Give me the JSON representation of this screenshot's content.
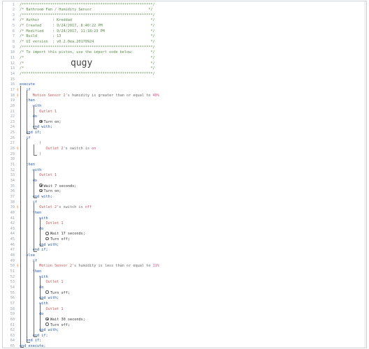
{
  "lines": [
    {
      "n": "1",
      "text": "/************************************************************/",
      "cls": "comment"
    },
    {
      "n": "2",
      "text": "/* Bathroom Fan / Humidity Sensor                          */",
      "cls": "comment"
    },
    {
      "n": "3",
      "text": "/************************************************************/",
      "cls": "comment"
    },
    {
      "n": "4",
      "text": "/* Author      : Kreddad                                    */",
      "cls": "comment"
    },
    {
      "n": "5",
      "text": "/* Created     : 9/24/2017, 8:40:22 PM                      */",
      "cls": "comment"
    },
    {
      "n": "6",
      "text": "/* Modified    : 9/24/2017, 11:18:23 PM                     */",
      "cls": "comment"
    },
    {
      "n": "7",
      "text": "/* Build       : 13                                         */",
      "cls": "comment"
    },
    {
      "n": "8",
      "text": "/* UI version  : v0.2.0ea.20170924                          */",
      "cls": "comment"
    },
    {
      "n": "9",
      "text": "/************************************************************/",
      "cls": "comment"
    },
    {
      "n": "10",
      "text": "/* To import this piston, use the import code below:        */",
      "cls": "comment"
    },
    {
      "n": "11",
      "text": "/*                                                          */",
      "cls": "comment"
    },
    {
      "n": "12",
      "text": "/*                                                          */",
      "cls": "comment"
    },
    {
      "n": "13",
      "text": "/*                                                          */",
      "cls": "comment"
    },
    {
      "n": "14",
      "text": "/************************************************************/",
      "cls": "comment"
    },
    {
      "n": "15",
      "text": ""
    },
    {
      "n": "16",
      "text": "execute",
      "cls": "kw"
    },
    {
      "n": "17",
      "text": "   if",
      "cls": "kw",
      "mark": true
    },
    {
      "n": "18",
      "seg": [
        {
          "t": "      "
        },
        {
          "t": "Motion Sensor 2",
          "c": "dev"
        },
        {
          "t": "'s humidity is greater than or equal to ",
          "c": "op"
        },
        {
          "t": "40%",
          "c": "num"
        }
      ],
      "mark": true
    },
    {
      "n": "19",
      "text": "   then",
      "cls": "kw"
    },
    {
      "n": "20",
      "text": "      with",
      "cls": "kw"
    },
    {
      "n": "21",
      "text": "         Outlet 1",
      "cls": "dev"
    },
    {
      "n": "22",
      "text": "      do",
      "cls": "kw"
    },
    {
      "n": "23",
      "text": "         Turn on;",
      "cls": "act",
      "radio": "filled"
    },
    {
      "n": "24",
      "text": "      end with;",
      "cls": "kw"
    },
    {
      "n": "25",
      "text": "   end if;",
      "cls": "kw"
    },
    {
      "n": "26",
      "text": "   if",
      "cls": "kw"
    },
    {
      "n": "27",
      "text": "         (",
      "cls": "op"
    },
    {
      "n": "28",
      "seg": [
        {
          "t": "            "
        },
        {
          "t": "Outlet 2",
          "c": "dev"
        },
        {
          "t": "'s switch is ",
          "c": "op"
        },
        {
          "t": "on",
          "c": "num"
        }
      ],
      "mark": true
    },
    {
      "n": "29",
      "text": "         )",
      "cls": "op"
    },
    {
      "n": "30",
      "text": ""
    },
    {
      "n": "31",
      "text": "   then",
      "cls": "kw"
    },
    {
      "n": "32",
      "text": "      with",
      "cls": "kw"
    },
    {
      "n": "33",
      "text": "         Outlet 1",
      "cls": "dev"
    },
    {
      "n": "34",
      "text": "      do",
      "cls": "kw"
    },
    {
      "n": "35",
      "text": "         Wait 7 seconds;",
      "cls": "act",
      "radio": "filled"
    },
    {
      "n": "36",
      "text": "         Turn on;",
      "cls": "act",
      "radio": "filled"
    },
    {
      "n": "37",
      "text": "      end with;",
      "cls": "kw"
    },
    {
      "n": "38",
      "text": "      if",
      "cls": "kw"
    },
    {
      "n": "39",
      "seg": [
        {
          "t": "         "
        },
        {
          "t": "Outlet 2",
          "c": "dev"
        },
        {
          "t": "'s switch is ",
          "c": "op"
        },
        {
          "t": "off",
          "c": "num"
        }
      ],
      "mark": true
    },
    {
      "n": "40",
      "text": "      then",
      "cls": "kw"
    },
    {
      "n": "41",
      "text": "         with",
      "cls": "kw"
    },
    {
      "n": "42",
      "text": "            Outlet 1",
      "cls": "dev"
    },
    {
      "n": "43",
      "text": "         do",
      "cls": "kw"
    },
    {
      "n": "44",
      "text": "            Wait 17 seconds;",
      "cls": "act",
      "radio": "empty"
    },
    {
      "n": "45",
      "text": "            Turn off;",
      "cls": "act",
      "radio": "empty"
    },
    {
      "n": "46",
      "text": "         end with;",
      "cls": "kw"
    },
    {
      "n": "47",
      "text": "      end if;",
      "cls": "kw"
    },
    {
      "n": "48",
      "text": "   else",
      "cls": "kw"
    },
    {
      "n": "49",
      "text": "      if",
      "cls": "kw"
    },
    {
      "n": "50",
      "seg": [
        {
          "t": "         "
        },
        {
          "t": "Motion Sensor 2",
          "c": "dev"
        },
        {
          "t": "'s humidity is less than or equal to ",
          "c": "op"
        },
        {
          "t": "11%",
          "c": "num"
        }
      ],
      "mark": true
    },
    {
      "n": "51",
      "text": "      then",
      "cls": "kw"
    },
    {
      "n": "52",
      "text": "         with",
      "cls": "kw"
    },
    {
      "n": "53",
      "text": "            Outlet 1",
      "cls": "dev"
    },
    {
      "n": "54",
      "text": "         do",
      "cls": "kw"
    },
    {
      "n": "55",
      "text": "            Turn off;",
      "cls": "act",
      "radio": "empty"
    },
    {
      "n": "56",
      "text": "         end with;",
      "cls": "kw"
    },
    {
      "n": "57",
      "text": "         with",
      "cls": "kw"
    },
    {
      "n": "58",
      "text": "            Outlet 1",
      "cls": "dev"
    },
    {
      "n": "59",
      "text": "         do",
      "cls": "kw"
    },
    {
      "n": "60",
      "text": "            Wait 30 seconds;",
      "cls": "act",
      "radio": "filled"
    },
    {
      "n": "61",
      "text": "            Turn off;",
      "cls": "act",
      "radio": "empty"
    },
    {
      "n": "62",
      "text": "         end with;",
      "cls": "kw"
    },
    {
      "n": "63",
      "text": "      end if;",
      "cls": "kw"
    },
    {
      "n": "64",
      "text": "   end if;",
      "cls": "kw"
    },
    {
      "n": "65",
      "text": "end execute;",
      "cls": "kw"
    }
  ],
  "import_code": "qugy",
  "marker_glyph": "§"
}
